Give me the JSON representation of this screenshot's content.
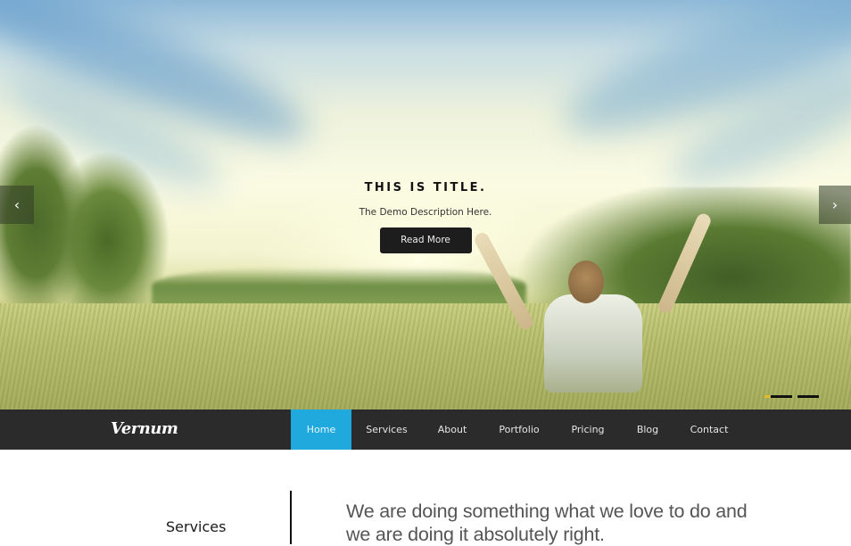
{
  "hero": {
    "title": "THIS IS TITLE.",
    "description": "The Demo Description Here.",
    "button_label": "Read More",
    "prev_arrow": "‹",
    "next_arrow": "›",
    "slides_count": 3,
    "active_slide": 1,
    "indicator_active_color": "#e9b92b"
  },
  "navbar": {
    "logo": "Vernum",
    "items": [
      {
        "label": "Home",
        "active": true
      },
      {
        "label": "Services",
        "active": false
      },
      {
        "label": "About",
        "active": false
      },
      {
        "label": "Portfolio",
        "active": false
      },
      {
        "label": "Pricing",
        "active": false
      },
      {
        "label": "Blog",
        "active": false
      },
      {
        "label": "Contact",
        "active": false
      }
    ],
    "accent_color": "#1fa9dc",
    "background_color": "#2b2b2b"
  },
  "intro": {
    "section_label": "Services",
    "headline": "We are doing something what we love to do and we are doing it absolutely right."
  }
}
